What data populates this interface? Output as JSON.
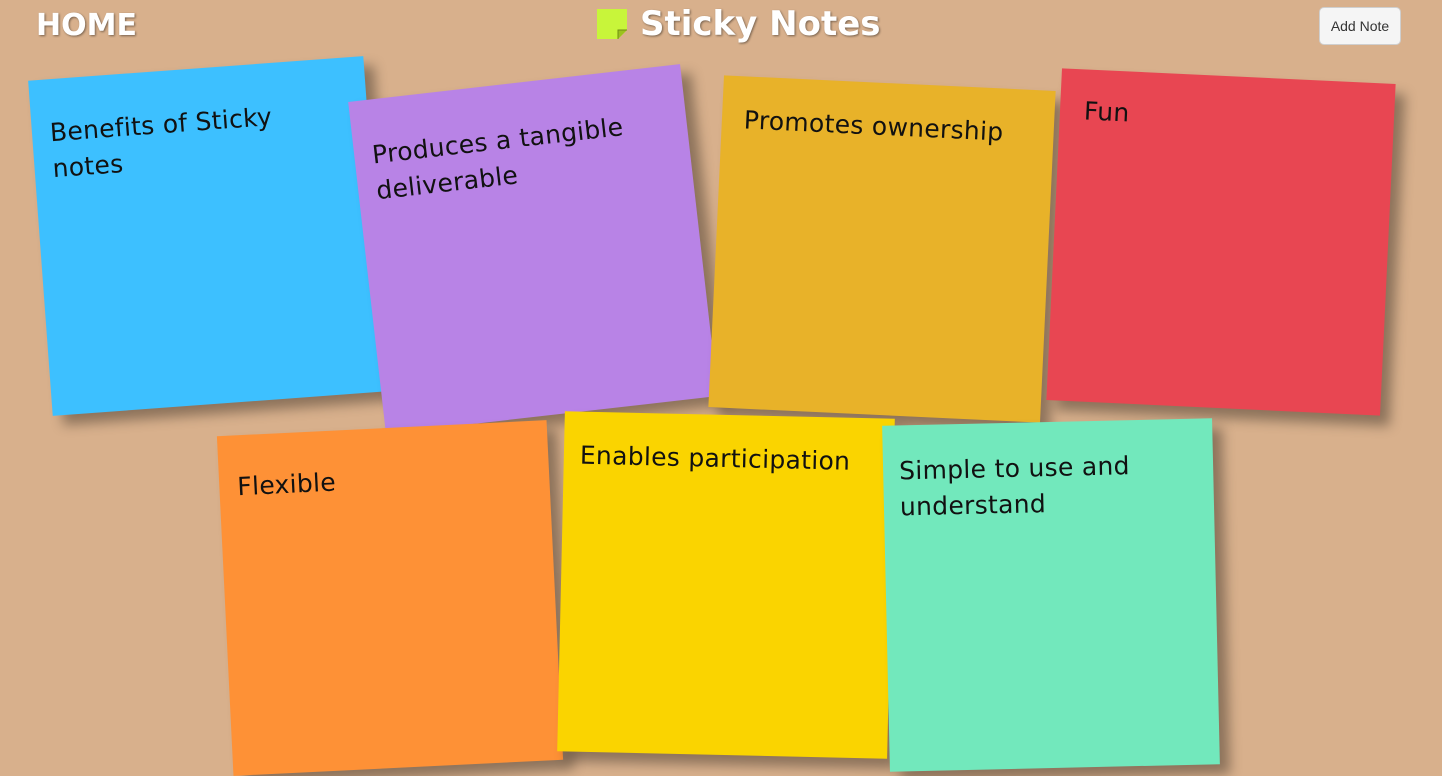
{
  "header": {
    "home_label": "HOME",
    "title": "Sticky Notes",
    "logo_icon": "sticky-note-icon",
    "logo_color": "#c8f53a",
    "add_note_label": "Add Note"
  },
  "colors": {
    "background": "#d8b08c"
  },
  "notes": [
    {
      "text": "Benefits of Sticky notes",
      "color": "#3dc0ff"
    },
    {
      "text": "Produces a tangible deliverable",
      "color": "#b883e6"
    },
    {
      "text": "Promotes ownership",
      "color": "#e8b229"
    },
    {
      "text": "Fun",
      "color": "#e84652"
    },
    {
      "text": "Flexible",
      "color": "#fe9136"
    },
    {
      "text": "Enables participation",
      "color": "#fad400"
    },
    {
      "text": "Simple to use and understand",
      "color": "#72e8bc"
    }
  ]
}
